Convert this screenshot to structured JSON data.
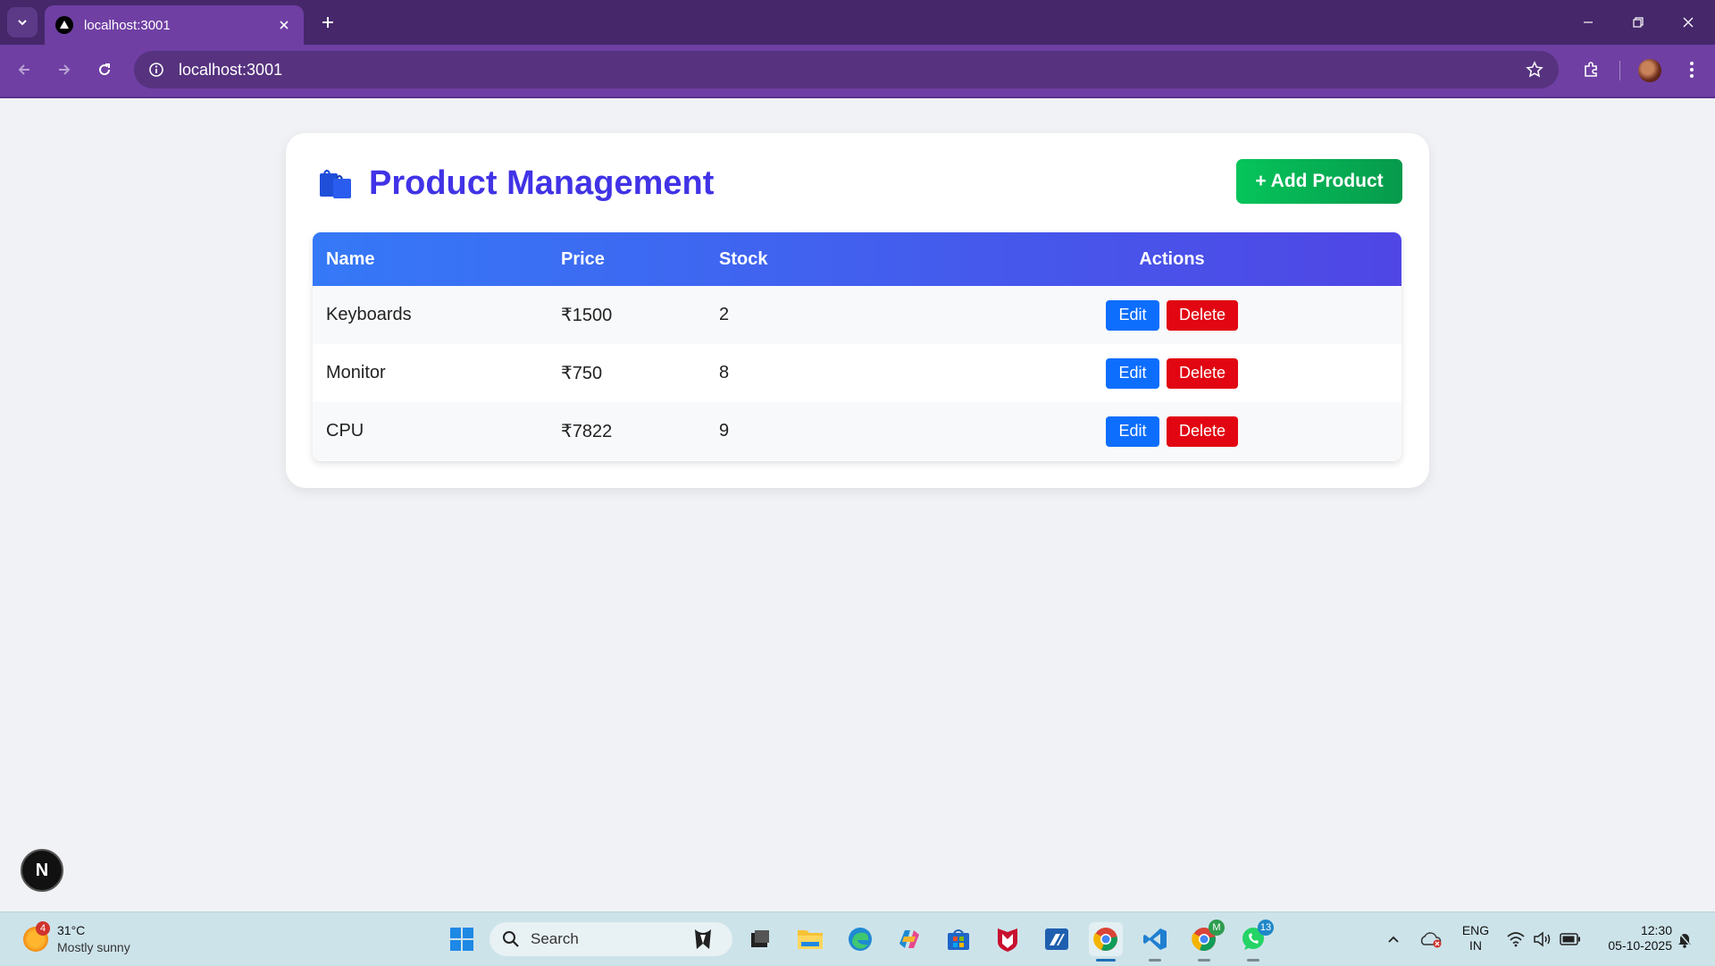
{
  "browser": {
    "tab_title": "localhost:3001",
    "url": "localhost:3001"
  },
  "page": {
    "title": "Product Management",
    "add_button": "+ Add Product",
    "columns": [
      "Name",
      "Price",
      "Stock",
      "Actions"
    ],
    "products": [
      {
        "name": "Keyboards",
        "price": "₹1500",
        "stock": "2"
      },
      {
        "name": "Monitor",
        "price": "₹750",
        "stock": "8"
      },
      {
        "name": "CPU",
        "price": "₹7822",
        "stock": "9"
      }
    ],
    "edit_label": "Edit",
    "delete_label": "Delete",
    "framework_badge": "N"
  },
  "taskbar": {
    "weather_temp": "31°C",
    "weather_desc": "Mostly sunny",
    "weather_alerts": "4",
    "search_placeholder": "Search",
    "chrome_profile_letter": "M",
    "whatsapp_count": "13",
    "lang_line1": "ENG",
    "lang_line2": "IN",
    "time": "12:30",
    "date": "05-10-2025"
  },
  "colors": {
    "title": "#4133e6",
    "add_button": "#06b050",
    "table_header_start": "#3579f7",
    "table_header_end": "#4f46e5",
    "edit_button": "#0d6efd",
    "delete_button": "#e10612",
    "browser_frame": "#6f3fa3"
  }
}
